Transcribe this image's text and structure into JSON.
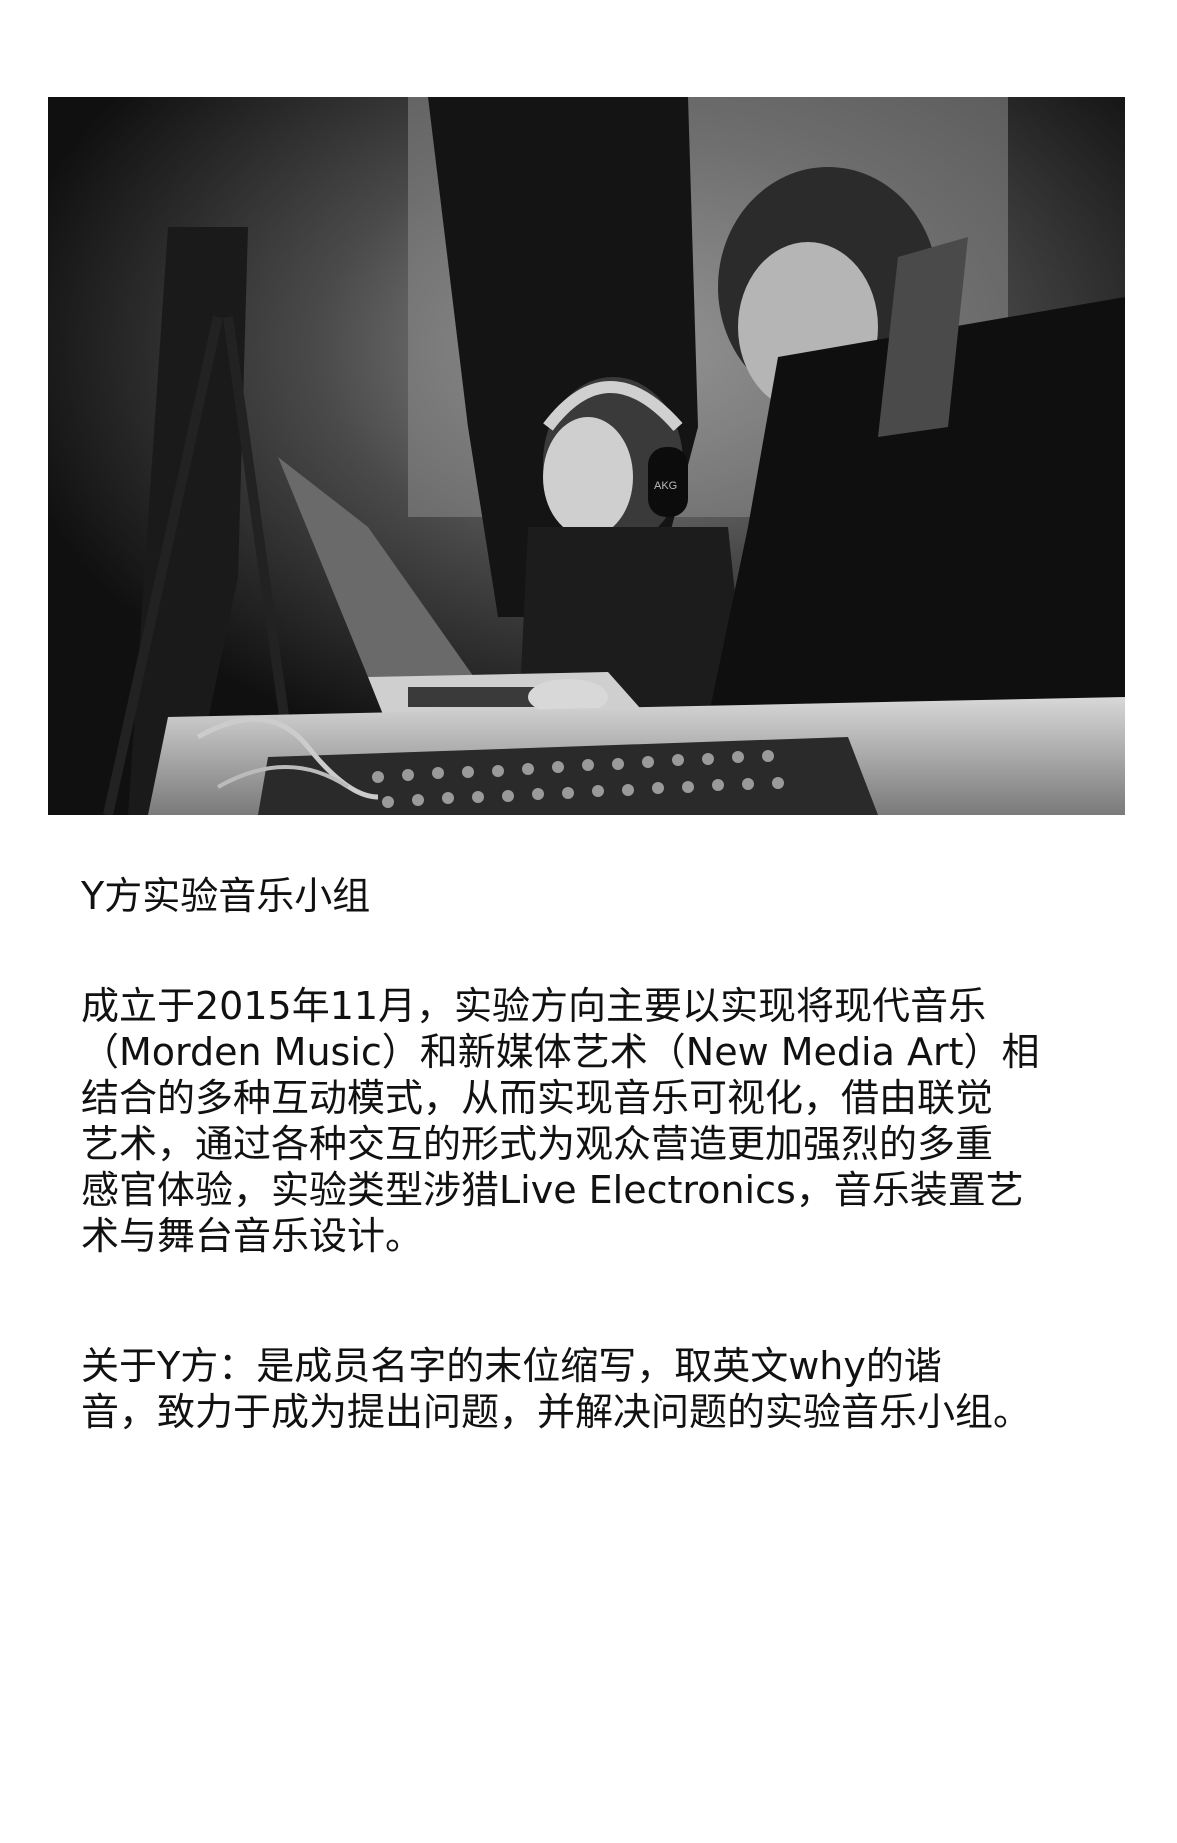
{
  "photo": {
    "alt": "",
    "headphone_brand": "AKG"
  },
  "title": "Y方实验音乐小组",
  "paragraph1": {
    "lines": [
      "成立于2015年11月，实验方向主要以实现将现代音乐",
      "（Morden Music）和新媒体艺术（New Media Art）相",
      "结合的多种互动模式，从而实现音乐可视化，借由联觉",
      "艺术，通过各种交互的形式为观众营造更加强烈的多重",
      "感官体验，实验类型涉猎Live Electronics，音乐装置艺",
      "术与舞台音乐设计。"
    ]
  },
  "paragraph2": {
    "lines": [
      "关于Y方：是成员名字的末位缩写，取英文why的谐",
      "音，致力于成为提出问题，并解决问题的实验音乐小组。"
    ]
  }
}
